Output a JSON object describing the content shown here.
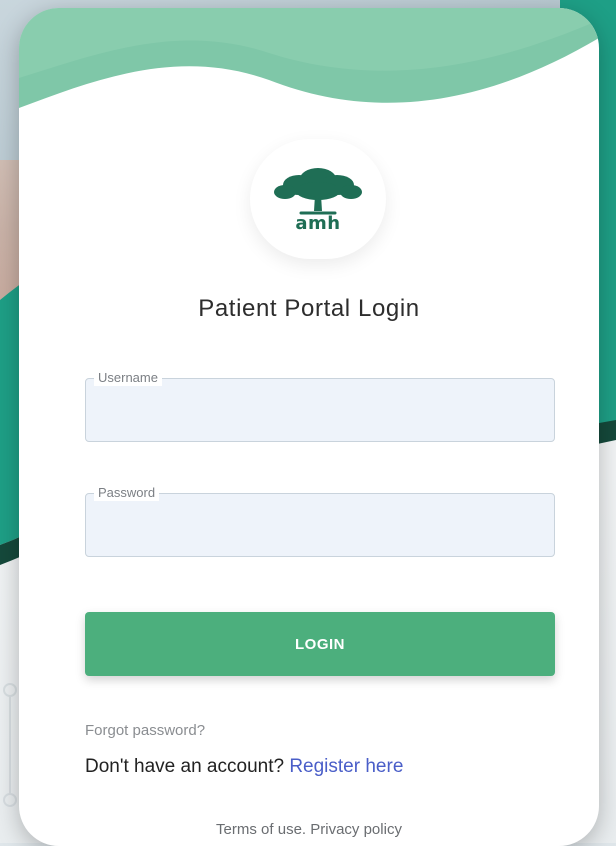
{
  "brand": {
    "logo_text": "amh",
    "logo_icon": "oak-tree-icon",
    "colors": {
      "brand_green": "#1f6e55",
      "wave_green": "#7fc7a8",
      "teal_band": "#1e9f86",
      "button_green": "#4caf7d",
      "link_blue": "#4a5ec8"
    }
  },
  "page": {
    "title": "Patient Portal Login"
  },
  "form": {
    "username": {
      "label": "Username",
      "value": ""
    },
    "password": {
      "label": "Password",
      "value": ""
    },
    "login_label": "LOGIN"
  },
  "links": {
    "forgot_password": "Forgot password?",
    "no_account_text": "Don't have an account?",
    "register": "Register here"
  },
  "footer": {
    "terms": "Terms of use.",
    "privacy": "Privacy policy"
  }
}
